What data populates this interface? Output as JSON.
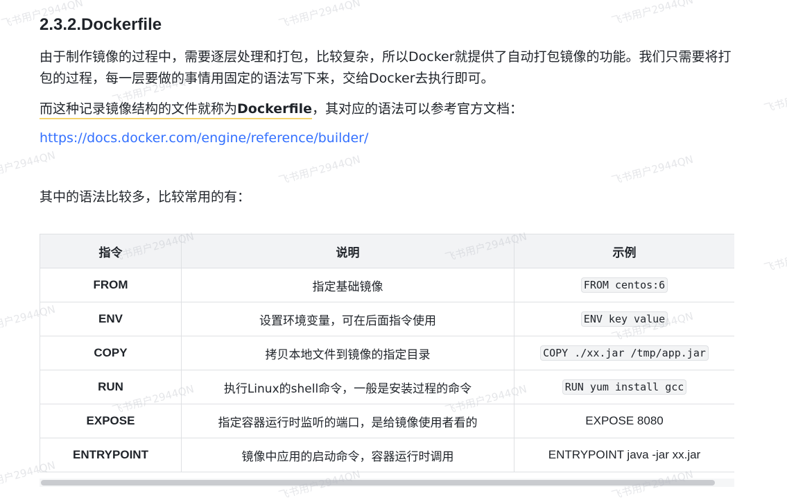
{
  "heading": "2.3.2.Dockerfile",
  "intro": "由于制作镜像的过程中，需要逐层处理和打包，比较复杂，所以Docker就提供了自动打包镜像的功能。我们只需要将打包的过程，每一层要做的事情用固定的语法写下来，交给Docker去执行即可。",
  "definition": {
    "before": "而这种记录镜像结构的文件就称为",
    "term": "Dockerfile",
    "after": "，其对应的语法可以参考官方文档："
  },
  "doc_link": "https://docs.docker.com/engine/reference/builder/",
  "syntax_intro": "其中的语法比较多，比较常用的有：",
  "table": {
    "headers": [
      "指令",
      "说明",
      "示例"
    ],
    "rows": [
      {
        "cmd": "FROM",
        "desc": "指定基础镜像",
        "example": "FROM centos:6",
        "code": true
      },
      {
        "cmd": "ENV",
        "desc": "设置环境变量，可在后面指令使用",
        "example": "ENV key value",
        "code": true
      },
      {
        "cmd": "COPY",
        "desc": "拷贝本地文件到镜像的指定目录",
        "example": "COPY ./xx.jar /tmp/app.jar",
        "code": true
      },
      {
        "cmd": "RUN",
        "desc": "执行Linux的shell命令，一般是安装过程的命令",
        "example": "RUN yum install gcc",
        "code": true
      },
      {
        "cmd": "EXPOSE",
        "desc": "指定容器运行时监听的端口，是给镜像使用者看的",
        "example": "EXPOSE 8080",
        "code": false
      },
      {
        "cmd": "ENTRYPOINT",
        "desc": "镜像中应用的启动命令，容器运行时调用",
        "example": "ENTRYPOINT java -jar xx.jar",
        "code": false
      }
    ]
  },
  "watermark": "飞书用户2944QN"
}
